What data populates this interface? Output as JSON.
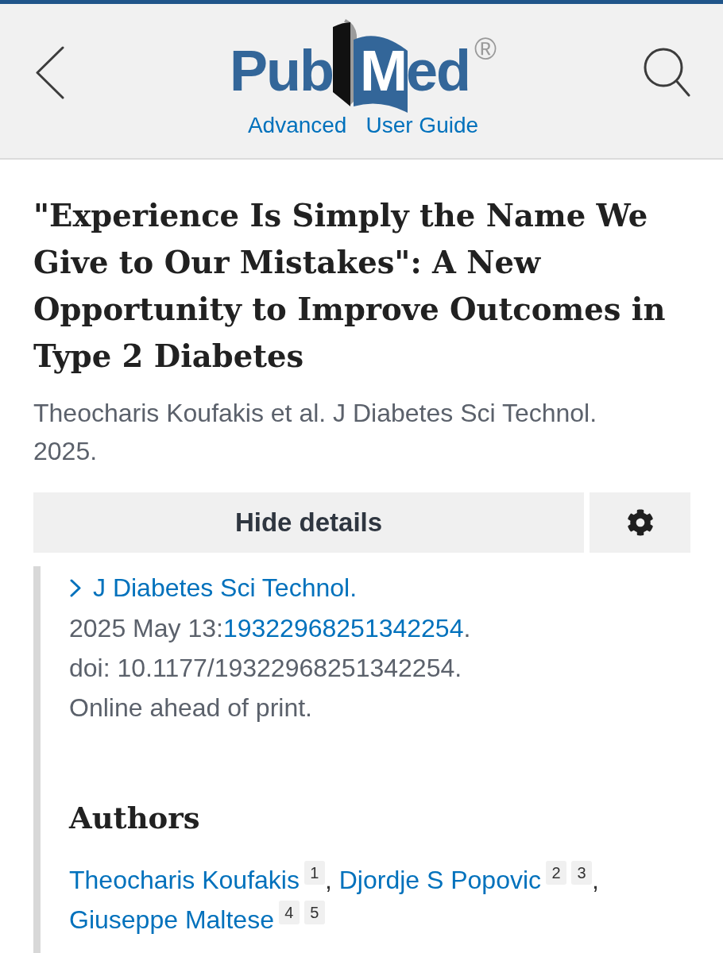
{
  "header": {
    "logo": {
      "text_1": "Pub",
      "text_2": "Med",
      "mark": "®"
    },
    "links": [
      "Advanced",
      "User Guide"
    ]
  },
  "article": {
    "title": "\"Experience Is Simply the Name We Give to Our Mistakes\": A New Opportunity to Improve Outcomes in Type 2 Diabetes",
    "byline": "Theocharis Koufakis et al. J Diabetes Sci Technol. 2025."
  },
  "details": {
    "toggle_label": "Hide details",
    "expanded": true,
    "journal": "J Diabetes Sci Technol.",
    "citation": {
      "date": "2025 May 13:",
      "article_id": "19322968251342254",
      "end": "."
    },
    "doi": "doi: 10.1177/19322968251342254.",
    "status": "Online ahead of print."
  },
  "authors": {
    "heading": "Authors",
    "list": [
      {
        "name": "Theocharis Koufakis",
        "affiliations": [
          "1"
        ],
        "separator": ","
      },
      {
        "name": "Djordje S Popovic",
        "affiliations": [
          "2",
          "3"
        ],
        "separator": ","
      },
      {
        "name": "Giuseppe Maltese",
        "affiliations": [
          "4",
          "5"
        ]
      }
    ]
  }
}
